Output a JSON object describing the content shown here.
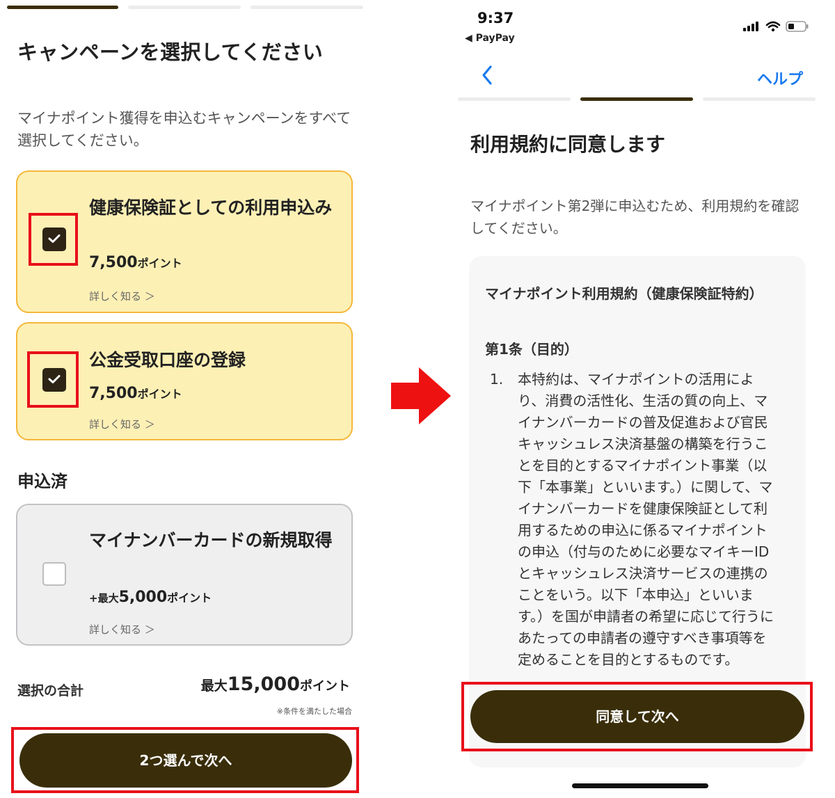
{
  "left": {
    "title": "キャンペーンを選択してください",
    "description": "マイナポイント獲得を申込むキャンペーンをすべて選択してください。",
    "campaigns": [
      {
        "title": "健康保険証としての利用申込み",
        "points_prefix": "",
        "points": "7,500",
        "points_unit": "ポイント",
        "link": "詳しく知る ＞",
        "checked": true
      },
      {
        "title": "公金受取口座の登録",
        "points_prefix": "",
        "points": "7,500",
        "points_unit": "ポイント",
        "link": "詳しく知る ＞",
        "checked": true
      }
    ],
    "applied_section": "申込済",
    "applied": {
      "title": "マイナンバーカードの新規取得",
      "points_prefix": "+最大",
      "points": "5,000",
      "points_unit": "ポイント",
      "link": "詳しく知る ＞",
      "checked": false
    },
    "total_label": "選択の合計",
    "total_prefix": "最大",
    "total_points": "15,000",
    "total_unit": "ポイント",
    "note": "※条件を満たした場合",
    "next_button": "2つ選んで次へ",
    "progress_steps": 3,
    "progress_current": 1
  },
  "right": {
    "status_time": "9:37",
    "back_app": "◀ PayPay",
    "help": "ヘルプ",
    "progress_steps": 3,
    "progress_current": 2,
    "title": "利用規約に同意します",
    "description": "マイナポイント第2弾に申込むため、利用規約を確認してください。",
    "terms_title": "マイナポイント利用規約（健康保険証特約）",
    "article": "第1条（目的）",
    "item_number": "1.",
    "item_text": "本特約は、マイナポイントの活用により、消費の活性化、生活の質の向上、マイナンバーカードの普及促進および官民キャッシュレス決済基盤の構築を行うことを目的とするマイナポイント事業（以下「本事業」といいます。）に関して、マイナンバーカードを健康保険証として利用するための申込に係るマイナポイントの申込（付与のために必要なマイキーIDとキャッシュレス決済サービスの連携のことをいう。以下「本申込」といいます。）を国が申請者の希望に応じて行うにあたっての申請者の遵守すべき事項等を定めることを目的とするものです。",
    "agree_button": "同意して次へ"
  },
  "colors": {
    "brand_dark": "#3a2e0a",
    "card_yellow": "#fdf0b5",
    "card_yellow_border": "#f4b73a",
    "highlight_red": "#e8101a",
    "link_blue": "#1a7af0"
  }
}
